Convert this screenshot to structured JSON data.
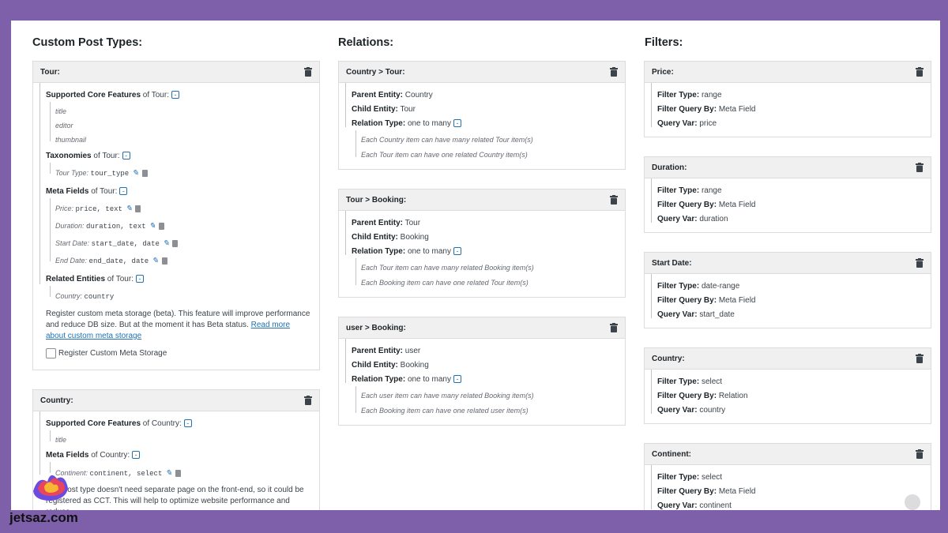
{
  "columns": {
    "cpt_title": "Custom Post Types:",
    "relations_title": "Relations:",
    "filters_title": "Filters:"
  },
  "tour": {
    "title": "Tour:",
    "features_label": "Supported Core Features",
    "features_of": " of Tour:",
    "features": [
      "title",
      "editor",
      "thumbnail"
    ],
    "taxonomies_label": "Taxonomies",
    "taxonomies_of": " of Tour:",
    "taxonomy_item": {
      "label": "Tour Type:",
      "value": "tour_type"
    },
    "meta_label": "Meta Fields",
    "meta_of": " of Tour:",
    "meta_items": [
      {
        "label": "Price:",
        "value": "price, text"
      },
      {
        "label": "Duration:",
        "value": "duration, text"
      },
      {
        "label": "Start Date:",
        "value": "start_date, date"
      },
      {
        "label": "End Date:",
        "value": "end_date, date"
      }
    ],
    "related_label": "Related Entities",
    "related_of": " of Tour:",
    "related_item": {
      "label": "Country:",
      "value": "country"
    },
    "note_text": "Register custom meta storage (beta). This feature will improve performance and reduce DB size. But at the moment it has Beta status. ",
    "note_link": "Read more about custom meta storage",
    "checkbox_label": "Register Custom Meta Storage"
  },
  "country": {
    "title": "Country:",
    "features_label": "Supported Core Features",
    "features_of": " of Country:",
    "features": [
      "title"
    ],
    "meta_label": "Meta Fields",
    "meta_of": " of Country:",
    "meta_item": {
      "label": "Continent:",
      "value": "continent, select"
    },
    "note_line1": "This post type doesn't need separate page on the front-end, so it could be",
    "note_line2": "registered as CCT. This will help to optimize website performance and reduce"
  },
  "relations": [
    {
      "title": "Country > Tour:",
      "parent_label": "Parent Entity:",
      "parent": "Country",
      "child_label": "Child Entity:",
      "child": "Tour",
      "type_label": "Relation Type:",
      "type": "one to many",
      "desc1": "Each Country item can have many related Tour item(s)",
      "desc2": "Each Tour item can have one related Country item(s)"
    },
    {
      "title": "Tour > Booking:",
      "parent_label": "Parent Entity:",
      "parent": "Tour",
      "child_label": "Child Entity:",
      "child": "Booking",
      "type_label": "Relation Type:",
      "type": "one to many",
      "desc1": "Each Tour item can have many related Booking item(s)",
      "desc2": "Each Booking item can have one related Tour item(s)"
    },
    {
      "title": "user > Booking:",
      "parent_label": "Parent Entity:",
      "parent": "user",
      "child_label": "Child Entity:",
      "child": "Booking",
      "type_label": "Relation Type:",
      "type": "one to many",
      "desc1": "Each user item can have many related Booking item(s)",
      "desc2": "Each Booking item can have one related user item(s)"
    }
  ],
  "filters": [
    {
      "title": "Price:",
      "type_label": "Filter Type:",
      "type": "range",
      "by_label": "Filter Query By:",
      "by": "Meta Field",
      "var_label": "Query Var:",
      "var": "price"
    },
    {
      "title": "Duration:",
      "type_label": "Filter Type:",
      "type": "range",
      "by_label": "Filter Query By:",
      "by": "Meta Field",
      "var_label": "Query Var:",
      "var": "duration"
    },
    {
      "title": "Start Date:",
      "type_label": "Filter Type:",
      "type": "date-range",
      "by_label": "Filter Query By:",
      "by": "Meta Field",
      "var_label": "Query Var:",
      "var": "start_date"
    },
    {
      "title": "Country:",
      "type_label": "Filter Type:",
      "type": "select",
      "by_label": "Filter Query By:",
      "by": "Relation",
      "var_label": "Query Var:",
      "var": "country"
    },
    {
      "title": "Continent:",
      "type_label": "Filter Type:",
      "type": "select",
      "by_label": "Filter Query By:",
      "by": "Meta Field",
      "var_label": "Query Var:",
      "var": "continent"
    }
  ],
  "watermark": "jetsaz.com",
  "icons": {
    "trash": "trash-icon",
    "edit": "pencil-icon",
    "collapse": "minus-icon"
  },
  "colors": {
    "background": "#7e5fa9",
    "link": "#2271b1",
    "header": "#f0f0f1"
  }
}
